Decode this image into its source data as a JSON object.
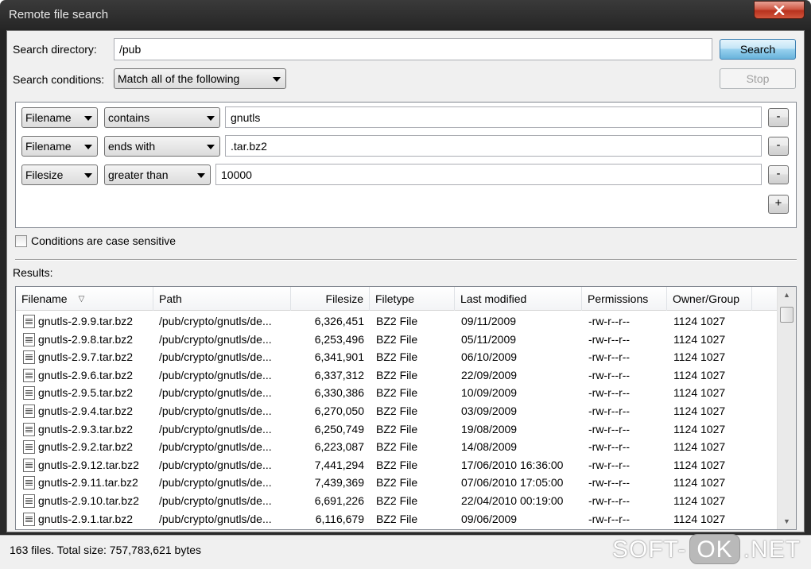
{
  "window": {
    "title": "Remote file search"
  },
  "search": {
    "directory_label": "Search directory:",
    "directory_value": "/pub",
    "conditions_label": "Search conditions:",
    "conditions_mode": "Match all of the following",
    "search_button": "Search",
    "stop_button": "Stop"
  },
  "conditions": [
    {
      "field": "Filename",
      "operator": "contains",
      "value": "gnutls",
      "remove": "-"
    },
    {
      "field": "Filename",
      "operator": "ends with",
      "value": ".tar.bz2",
      "remove": "-"
    },
    {
      "field": "Filesize",
      "operator": "greater than",
      "value": "10000",
      "remove": "-"
    }
  ],
  "add_condition": "+",
  "case_sensitive": {
    "label": "Conditions are case sensitive",
    "checked": false
  },
  "results": {
    "label": "Results:",
    "columns": [
      "Filename",
      "Path",
      "Filesize",
      "Filetype",
      "Last modified",
      "Permissions",
      "Owner/Group"
    ],
    "sort_indicator": "▽",
    "rows": [
      [
        "gnutls-2.9.9.tar.bz2",
        "/pub/crypto/gnutls/de...",
        "6,326,451",
        "BZ2 File",
        "09/11/2009",
        "-rw-r--r--",
        "1124 1027"
      ],
      [
        "gnutls-2.9.8.tar.bz2",
        "/pub/crypto/gnutls/de...",
        "6,253,496",
        "BZ2 File",
        "05/11/2009",
        "-rw-r--r--",
        "1124 1027"
      ],
      [
        "gnutls-2.9.7.tar.bz2",
        "/pub/crypto/gnutls/de...",
        "6,341,901",
        "BZ2 File",
        "06/10/2009",
        "-rw-r--r--",
        "1124 1027"
      ],
      [
        "gnutls-2.9.6.tar.bz2",
        "/pub/crypto/gnutls/de...",
        "6,337,312",
        "BZ2 File",
        "22/09/2009",
        "-rw-r--r--",
        "1124 1027"
      ],
      [
        "gnutls-2.9.5.tar.bz2",
        "/pub/crypto/gnutls/de...",
        "6,330,386",
        "BZ2 File",
        "10/09/2009",
        "-rw-r--r--",
        "1124 1027"
      ],
      [
        "gnutls-2.9.4.tar.bz2",
        "/pub/crypto/gnutls/de...",
        "6,270,050",
        "BZ2 File",
        "03/09/2009",
        "-rw-r--r--",
        "1124 1027"
      ],
      [
        "gnutls-2.9.3.tar.bz2",
        "/pub/crypto/gnutls/de...",
        "6,250,749",
        "BZ2 File",
        "19/08/2009",
        "-rw-r--r--",
        "1124 1027"
      ],
      [
        "gnutls-2.9.2.tar.bz2",
        "/pub/crypto/gnutls/de...",
        "6,223,087",
        "BZ2 File",
        "14/08/2009",
        "-rw-r--r--",
        "1124 1027"
      ],
      [
        "gnutls-2.9.12.tar.bz2",
        "/pub/crypto/gnutls/de...",
        "7,441,294",
        "BZ2 File",
        "17/06/2010 16:36:00",
        "-rw-r--r--",
        "1124 1027"
      ],
      [
        "gnutls-2.9.11.tar.bz2",
        "/pub/crypto/gnutls/de...",
        "7,439,369",
        "BZ2 File",
        "07/06/2010 17:05:00",
        "-rw-r--r--",
        "1124 1027"
      ],
      [
        "gnutls-2.9.10.tar.bz2",
        "/pub/crypto/gnutls/de...",
        "6,691,226",
        "BZ2 File",
        "22/04/2010 00:19:00",
        "-rw-r--r--",
        "1124 1027"
      ],
      [
        "gnutls-2.9.1.tar.bz2",
        "/pub/crypto/gnutls/de...",
        "6,116,679",
        "BZ2 File",
        "09/06/2009",
        "-rw-r--r--",
        "1124 1027"
      ]
    ]
  },
  "status": {
    "text": "163 files. Total size: 757,783,621 bytes"
  },
  "watermark": {
    "left": "SOFT-",
    "ok": "OK",
    "right": ".NET"
  },
  "icons": {
    "close": "close-icon",
    "file": "bz2-file-icon",
    "scroll_up": "scroll-up-icon",
    "scroll_down": "scroll-down-icon"
  },
  "colors": {
    "close_button": "#c8452f",
    "search_button": "#98d1ef"
  }
}
